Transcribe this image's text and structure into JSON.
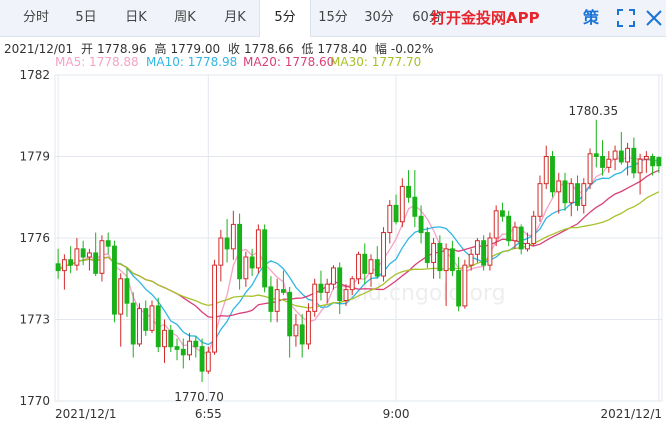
{
  "tabs": [
    {
      "label": "分时"
    },
    {
      "label": "5日"
    },
    {
      "label": "日K"
    },
    {
      "label": "周K"
    },
    {
      "label": "月K"
    },
    {
      "label": "5分"
    },
    {
      "label": "15分"
    },
    {
      "label": "30分"
    },
    {
      "label": "60分"
    }
  ],
  "active_tab": "5分",
  "app_link": "打开金投网APP",
  "strategy_label": "策",
  "icons": [
    "fullscreen-icon",
    "close-icon"
  ],
  "info": {
    "date": "2021/12/01",
    "open_label": "开",
    "open": "1778.96",
    "high_label": "高",
    "high": "1779.00",
    "close_label": "收",
    "close": "1778.66",
    "low_label": "低",
    "low": "1778.40",
    "change_label": "幅",
    "change": "-0.02%"
  },
  "ma_legend": [
    {
      "label": "MA5: 1778.88",
      "color": "#f5a3c7"
    },
    {
      "label": "MA10: 1778.98",
      "color": "#31b6e3"
    },
    {
      "label": "MA20: 1778.60",
      "color": "#d9407a"
    },
    {
      "label": "MA30: 1777.70",
      "color": "#a8c02a"
    }
  ],
  "watermark": "gold.cngold.org",
  "colors": {
    "up": "#d22b2b",
    "down": "#19b219",
    "grid": "#e3e8ef",
    "text": "#333333"
  },
  "chart_data": {
    "type": "candlestick",
    "ylim": [
      1770,
      1782
    ],
    "yticks": [
      1770,
      1773,
      1776,
      1779,
      1782
    ],
    "xtick_labels": [
      {
        "i": 0,
        "label": "2021/12/1"
      },
      {
        "i": 24,
        "label": "6:55"
      },
      {
        "i": 54,
        "label": "9:00"
      },
      {
        "i": 96,
        "label": "2021/12/1"
      }
    ],
    "annotations": [
      {
        "i": 86,
        "value": 1780.35,
        "label": "1780.35",
        "position": "above"
      },
      {
        "i": 23,
        "value": 1770.7,
        "label": "1770.70",
        "position": "below"
      }
    ],
    "candles": [
      [
        1775.05,
        1775.6,
        1774.5,
        1774.8
      ],
      [
        1774.8,
        1775.4,
        1774.1,
        1775.2
      ],
      [
        1775.2,
        1775.7,
        1774.7,
        1775.0
      ],
      [
        1775.0,
        1776.0,
        1774.8,
        1775.6
      ],
      [
        1775.6,
        1775.9,
        1775.0,
        1775.3
      ],
      [
        1775.3,
        1775.6,
        1774.8,
        1775.45
      ],
      [
        1775.45,
        1776.2,
        1774.6,
        1774.7
      ],
      [
        1774.7,
        1776.1,
        1774.4,
        1775.9
      ],
      [
        1775.9,
        1776.2,
        1775.4,
        1775.7
      ],
      [
        1775.7,
        1775.9,
        1772.9,
        1773.2
      ],
      [
        1773.2,
        1774.7,
        1772.0,
        1774.5
      ],
      [
        1774.5,
        1774.9,
        1773.1,
        1773.6
      ],
      [
        1773.6,
        1774.0,
        1771.6,
        1772.1
      ],
      [
        1772.1,
        1773.6,
        1772.0,
        1773.4
      ],
      [
        1773.4,
        1773.7,
        1772.4,
        1772.6
      ],
      [
        1772.6,
        1773.7,
        1772.5,
        1773.5
      ],
      [
        1773.5,
        1773.8,
        1771.8,
        1772.0
      ],
      [
        1772.0,
        1773.0,
        1771.4,
        1772.6
      ],
      [
        1772.6,
        1772.8,
        1771.8,
        1772.0
      ],
      [
        1772.0,
        1772.3,
        1771.5,
        1771.9
      ],
      [
        1771.9,
        1772.3,
        1771.2,
        1771.7
      ],
      [
        1771.7,
        1772.5,
        1771.5,
        1772.2
      ],
      [
        1772.2,
        1772.4,
        1771.6,
        1772.0
      ],
      [
        1772.0,
        1772.3,
        1770.7,
        1771.1
      ],
      [
        1771.1,
        1772.0,
        1771.0,
        1771.8
      ],
      [
        1771.8,
        1775.2,
        1771.7,
        1775.0
      ],
      [
        1775.0,
        1776.3,
        1774.4,
        1776.0
      ],
      [
        1776.0,
        1776.7,
        1775.1,
        1775.6
      ],
      [
        1775.6,
        1777.0,
        1775.2,
        1776.5
      ],
      [
        1776.5,
        1776.9,
        1774.1,
        1774.5
      ],
      [
        1774.5,
        1775.5,
        1774.2,
        1775.3
      ],
      [
        1775.3,
        1775.6,
        1774.6,
        1774.9
      ],
      [
        1774.9,
        1776.5,
        1774.7,
        1776.3
      ],
      [
        1776.3,
        1776.5,
        1774.0,
        1774.2
      ],
      [
        1774.2,
        1774.6,
        1772.9,
        1773.3
      ],
      [
        1773.3,
        1774.5,
        1772.9,
        1774.1
      ],
      [
        1774.1,
        1774.8,
        1773.9,
        1774.0
      ],
      [
        1774.0,
        1774.2,
        1771.6,
        1772.4
      ],
      [
        1772.4,
        1773.2,
        1772.0,
        1772.8
      ],
      [
        1772.8,
        1773.2,
        1771.6,
        1772.1
      ],
      [
        1772.1,
        1773.6,
        1771.9,
        1773.3
      ],
      [
        1773.3,
        1774.5,
        1773.1,
        1774.3
      ],
      [
        1774.3,
        1774.8,
        1773.7,
        1774.0
      ],
      [
        1774.0,
        1774.5,
        1773.6,
        1774.3
      ],
      [
        1774.3,
        1775.0,
        1774.1,
        1774.9
      ],
      [
        1774.9,
        1775.1,
        1773.2,
        1773.7
      ],
      [
        1773.7,
        1774.3,
        1773.5,
        1774.1
      ],
      [
        1774.1,
        1774.6,
        1773.9,
        1774.5
      ],
      [
        1774.5,
        1775.5,
        1774.3,
        1775.4
      ],
      [
        1775.4,
        1775.8,
        1774.3,
        1774.7
      ],
      [
        1774.7,
        1775.4,
        1774.2,
        1775.2
      ],
      [
        1775.2,
        1775.7,
        1774.5,
        1774.6
      ],
      [
        1774.6,
        1776.4,
        1774.4,
        1776.2
      ],
      [
        1776.2,
        1777.4,
        1775.8,
        1777.2
      ],
      [
        1777.2,
        1777.6,
        1776.5,
        1776.6
      ],
      [
        1776.6,
        1778.2,
        1776.4,
        1777.9
      ],
      [
        1777.9,
        1778.5,
        1777.3,
        1777.5
      ],
      [
        1777.5,
        1778.5,
        1776.4,
        1776.8
      ],
      [
        1776.8,
        1777.2,
        1775.8,
        1776.2
      ],
      [
        1776.2,
        1776.4,
        1774.9,
        1775.1
      ],
      [
        1775.1,
        1776.0,
        1774.5,
        1775.8
      ],
      [
        1775.8,
        1776.1,
        1774.5,
        1774.8
      ],
      [
        1774.8,
        1775.8,
        1773.5,
        1775.6
      ],
      [
        1775.6,
        1775.9,
        1774.6,
        1774.8
      ],
      [
        1774.8,
        1775.3,
        1773.3,
        1773.5
      ],
      [
        1773.5,
        1775.2,
        1773.4,
        1775.0
      ],
      [
        1775.0,
        1775.6,
        1774.8,
        1775.4
      ],
      [
        1775.4,
        1776.0,
        1775.1,
        1775.9
      ],
      [
        1775.9,
        1776.1,
        1774.8,
        1775.0
      ],
      [
        1775.0,
        1776.2,
        1774.8,
        1776.0
      ],
      [
        1776.0,
        1777.2,
        1775.7,
        1777.0
      ],
      [
        1777.0,
        1777.3,
        1776.6,
        1776.8
      ],
      [
        1776.8,
        1777.0,
        1775.7,
        1775.9
      ],
      [
        1775.9,
        1776.6,
        1775.6,
        1776.4
      ],
      [
        1776.4,
        1776.5,
        1775.4,
        1775.6
      ],
      [
        1775.6,
        1776.2,
        1775.5,
        1775.8
      ],
      [
        1775.8,
        1777.0,
        1775.7,
        1776.8
      ],
      [
        1776.8,
        1778.3,
        1776.6,
        1778.0
      ],
      [
        1778.0,
        1779.4,
        1777.8,
        1779.0
      ],
      [
        1779.0,
        1779.2,
        1777.5,
        1777.7
      ],
      [
        1777.7,
        1778.4,
        1776.9,
        1778.1
      ],
      [
        1778.1,
        1778.4,
        1777.0,
        1777.3
      ],
      [
        1777.3,
        1778.2,
        1776.8,
        1778.0
      ],
      [
        1778.0,
        1778.3,
        1777.0,
        1777.2
      ],
      [
        1777.2,
        1778.2,
        1776.9,
        1778.0
      ],
      [
        1778.0,
        1779.3,
        1777.8,
        1779.1
      ],
      [
        1779.1,
        1780.35,
        1778.6,
        1779.0
      ],
      [
        1779.0,
        1779.6,
        1778.3,
        1778.6
      ],
      [
        1778.6,
        1779.2,
        1778.4,
        1778.9
      ],
      [
        1778.9,
        1779.4,
        1778.5,
        1779.2
      ],
      [
        1779.2,
        1779.9,
        1778.7,
        1778.8
      ],
      [
        1778.8,
        1779.5,
        1778.3,
        1779.3
      ],
      [
        1779.3,
        1779.7,
        1778.2,
        1778.4
      ],
      [
        1778.4,
        1779.1,
        1777.6,
        1778.9
      ],
      [
        1778.9,
        1779.2,
        1778.4,
        1779.0
      ],
      [
        1779.0,
        1779.1,
        1778.3,
        1778.66
      ],
      [
        1778.96,
        1779.0,
        1778.4,
        1778.66
      ]
    ]
  }
}
